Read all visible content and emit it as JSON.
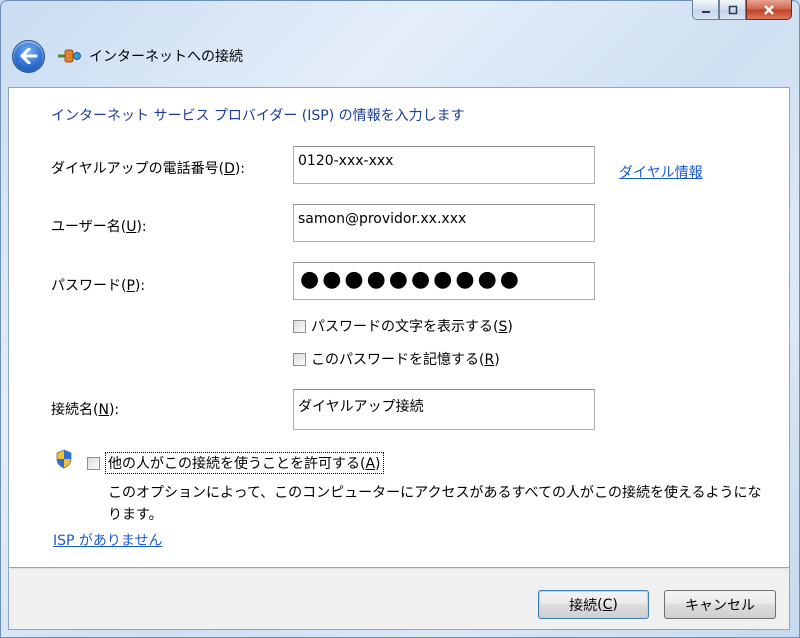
{
  "window": {
    "title": "インターネットへの接続"
  },
  "caption": {
    "minimize_icon": "minimize-icon",
    "maximize_icon": "maximize-icon",
    "close_icon": "close-icon"
  },
  "form": {
    "heading": "インターネット サービス プロバイダー (ISP) の情報を入力します",
    "phone": {
      "label": "ダイヤルアップの電話番号",
      "accesskey": "D",
      "value": "0120-xxx-xxx"
    },
    "dial_info_link": "ダイヤル情報",
    "username": {
      "label": "ユーザー名",
      "accesskey": "U",
      "value": "samon@providor.xx.xxx"
    },
    "password": {
      "label": "パスワード",
      "accesskey": "P",
      "value": "●●●●●●●●●●"
    },
    "show_chars": {
      "label": "パスワードの文字を表示する",
      "accesskey": "S",
      "checked": false
    },
    "remember": {
      "label": "このパスワードを記憶する",
      "accesskey": "R",
      "checked": false
    },
    "conn_name": {
      "label": "接続名",
      "accesskey": "N",
      "value": "ダイヤルアップ接続"
    },
    "allow_others": {
      "label": "他の人がこの接続を使うことを許可する",
      "accesskey": "A",
      "checked": false
    },
    "allow_desc": "このオプションによって、このコンピューターにアクセスがあるすべての人がこの接続を使えるようになります。",
    "no_isp_link": "ISP がありません"
  },
  "buttons": {
    "connect": {
      "label": "接続",
      "accesskey": "C"
    },
    "cancel": "キャンセル"
  },
  "colors": {
    "heading": "#1b3d9c",
    "link": "#1a5ccf",
    "back_button": "#2f6fcf",
    "close_button": "#c13f24"
  }
}
